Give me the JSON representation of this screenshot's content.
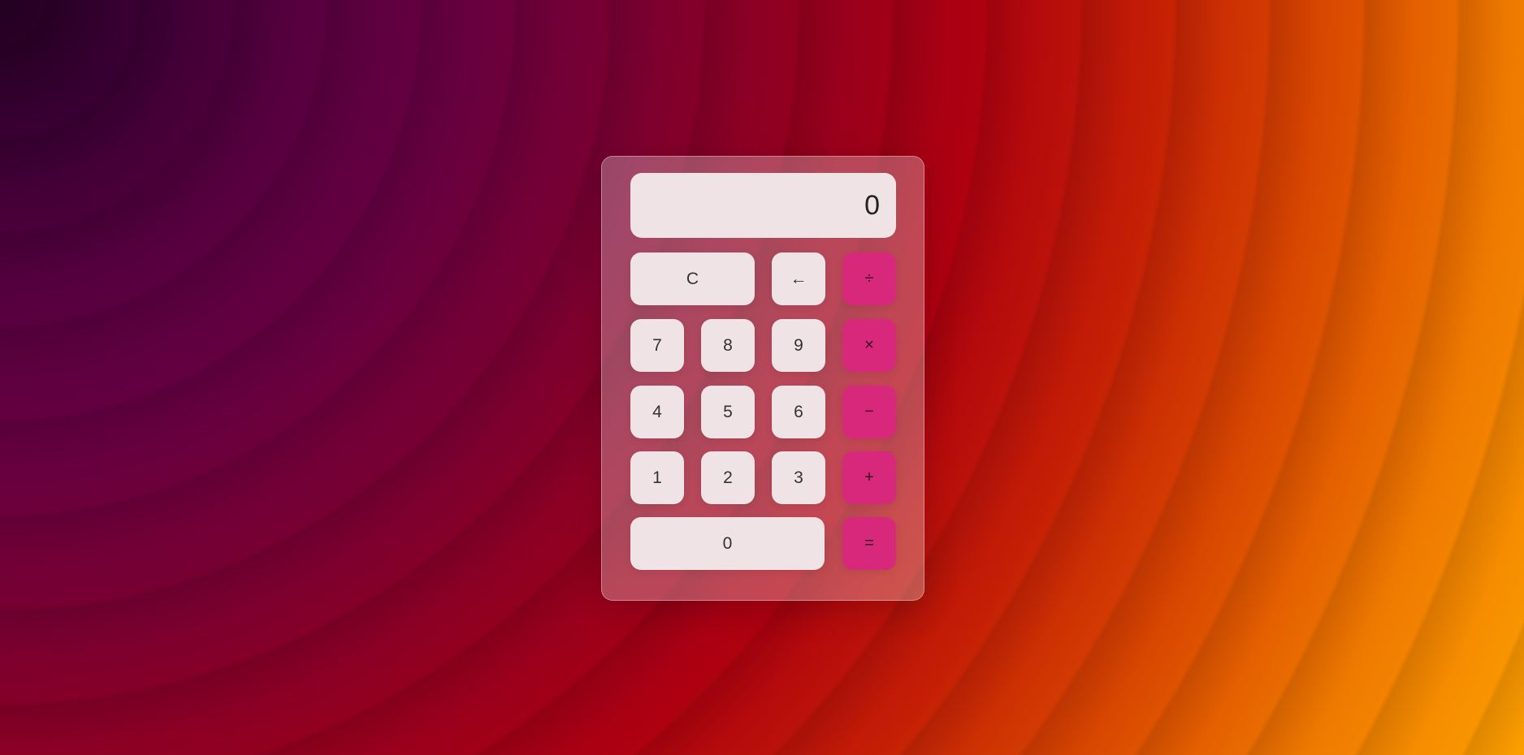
{
  "calculator": {
    "display_value": "0",
    "keys": {
      "clear": "C",
      "backspace": "←",
      "divide": "÷",
      "multiply": "×",
      "subtract": "−",
      "add": "+",
      "equals": "=",
      "d0": "0",
      "d1": "1",
      "d2": "2",
      "d3": "3",
      "d4": "4",
      "d5": "5",
      "d6": "6",
      "d7": "7",
      "d8": "8",
      "d9": "9"
    }
  },
  "colors": {
    "operator_accent": "#d8287c",
    "key_background": "#f0e3e6"
  }
}
